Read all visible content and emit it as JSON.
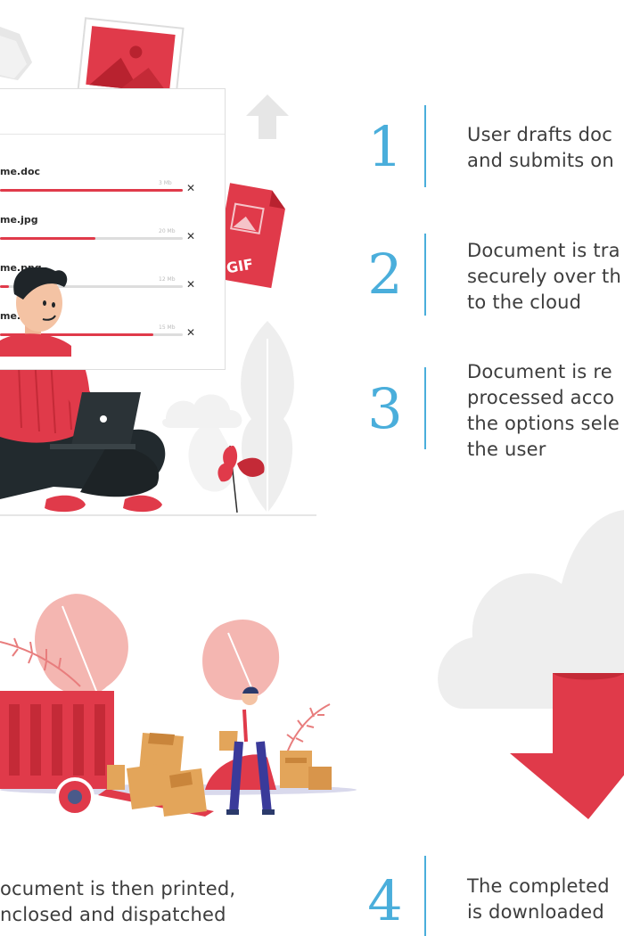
{
  "steps": [
    {
      "num": "1",
      "lines": [
        "User drafts doc",
        "and submits on"
      ]
    },
    {
      "num": "2",
      "lines": [
        "Document is tra",
        "securely over th",
        "to the cloud"
      ]
    },
    {
      "num": "3",
      "lines": [
        "Document is re",
        "processed acco",
        "the options sele",
        "the user"
      ]
    },
    {
      "num": "4",
      "lines": [
        "The completed",
        "is downloaded"
      ]
    }
  ],
  "bottom_left_text": [
    "ocument is then printed,",
    "nclosed and dispatched"
  ],
  "upload_panel": {
    "files": [
      {
        "name": "me.doc",
        "size": "3 Mb",
        "progress": 1.0
      },
      {
        "name": "me.jpg",
        "size": "20 Mb",
        "progress": 0.52
      },
      {
        "name": "me.png",
        "size": "12 Mb",
        "progress": 0.05
      },
      {
        "name": "me.",
        "size": "15 Mb",
        "progress": 0.84
      }
    ],
    "gif_label": "GIF"
  },
  "colors": {
    "accent_red": "#e03a4a",
    "step_blue": "#4aaedb",
    "text_dark": "#3d3d3d",
    "cloud_gray": "#eeeeee",
    "box_orange": "#e3a55a"
  },
  "icons": [
    "image-icon",
    "document-stack-icon",
    "upload-arrow-icon",
    "gif-file-icon",
    "laptop-icon",
    "cloud-icon",
    "download-arrow-icon",
    "close-icon"
  ]
}
